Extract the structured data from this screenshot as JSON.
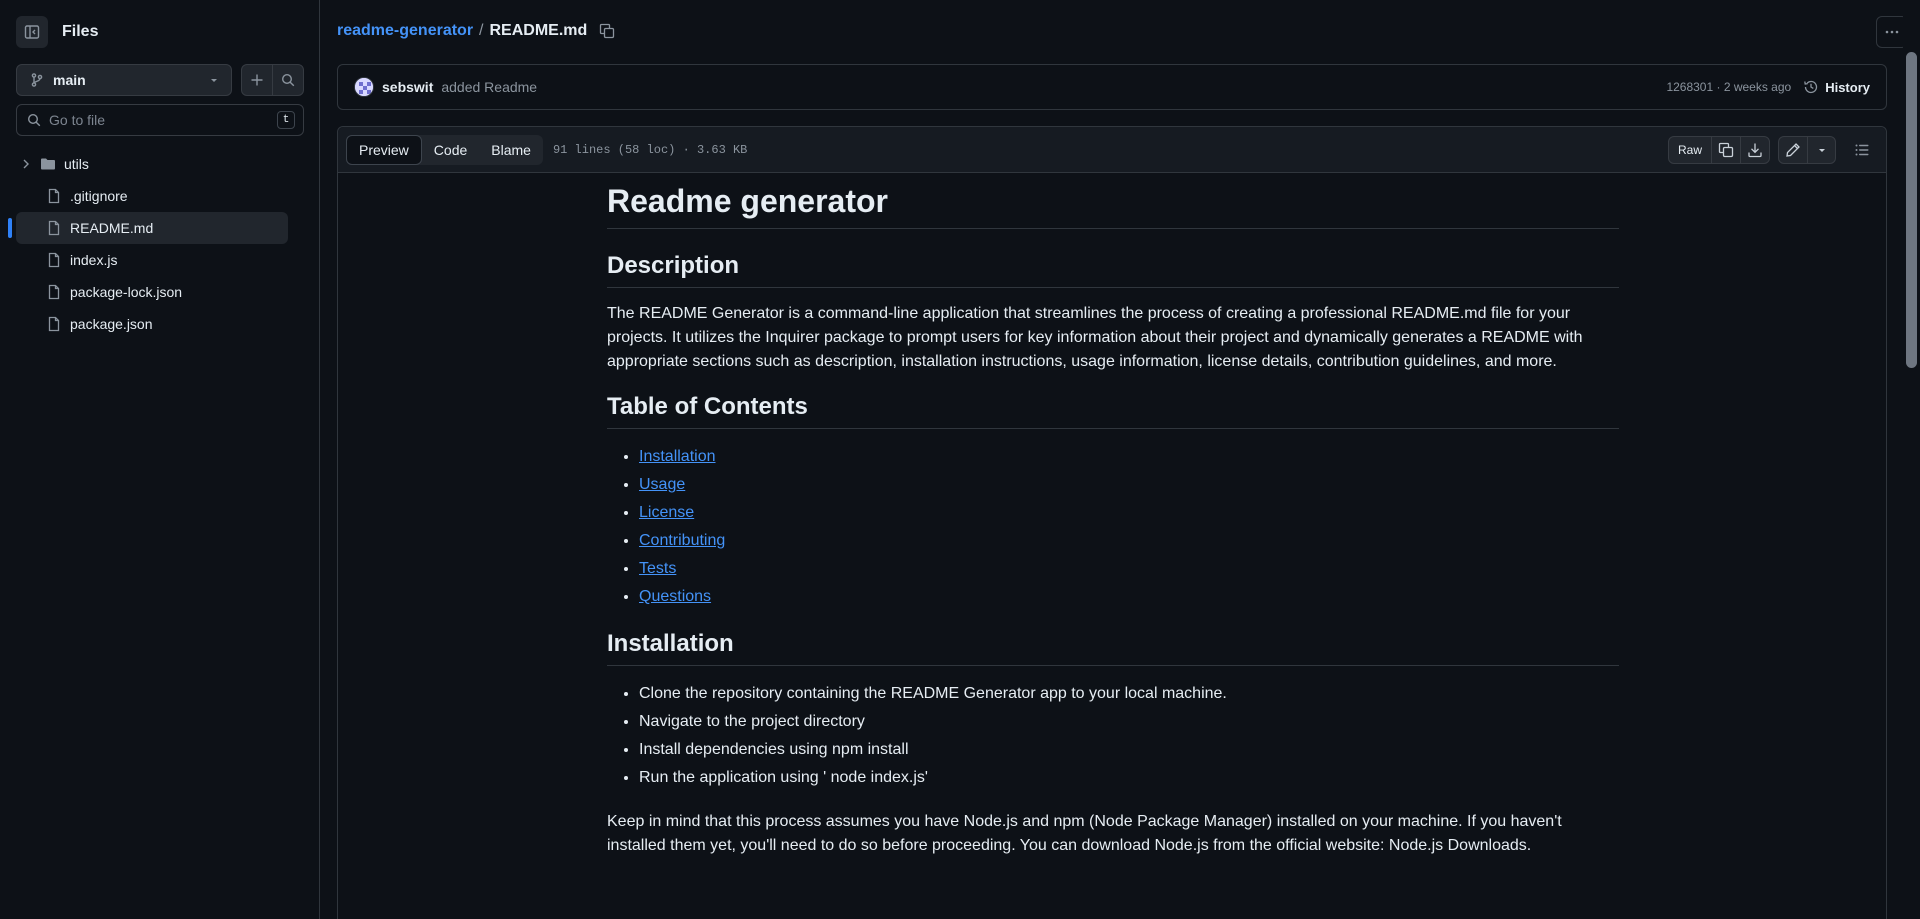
{
  "sidebar": {
    "title": "Files",
    "branch": "main",
    "goto_placeholder": "Go to file",
    "goto_shortcut": "t",
    "tree": [
      {
        "name": "utils",
        "type": "folder"
      },
      {
        "name": ".gitignore",
        "type": "file"
      },
      {
        "name": "README.md",
        "type": "file",
        "selected": true
      },
      {
        "name": "index.js",
        "type": "file"
      },
      {
        "name": "package-lock.json",
        "type": "file"
      },
      {
        "name": "package.json",
        "type": "file"
      }
    ]
  },
  "breadcrumb": {
    "repo": "readme-generator",
    "separator": "/",
    "file": "README.md"
  },
  "commit": {
    "author": "sebswit",
    "message": "added Readme",
    "meta": "1268301 · 2 weeks ago",
    "history_label": "History"
  },
  "file_header": {
    "tabs": [
      "Preview",
      "Code",
      "Blame"
    ],
    "active_tab": "Preview",
    "info": "91 lines (58 loc) · 3.63 KB",
    "raw_label": "Raw"
  },
  "readme": {
    "title": "Readme generator",
    "description_heading": "Description",
    "description": "The README Generator is a command-line application that streamlines the process of creating a professional README.md file for your projects. It utilizes the Inquirer package to prompt users for key information about their project and dynamically generates a README with appropriate sections such as description, installation instructions, usage information, license details, contribution guidelines, and more.",
    "toc_heading": "Table of Contents",
    "toc": [
      "Installation",
      "Usage",
      "License",
      "Contributing",
      "Tests",
      "Questions"
    ],
    "installation_heading": "Installation",
    "installation_steps": [
      "Clone the repository containing the README Generator app to your local machine.",
      "Navigate to the project directory",
      "Install dependencies using npm install",
      "Run the application using ' node index.js'"
    ],
    "installation_note": "Keep in mind that this process assumes you have Node.js and npm (Node Package Manager) installed on your machine. If you haven't installed them yet, you'll need to do so before proceeding. You can download Node.js from the official website: Node.js Downloads."
  },
  "colors": {
    "background": "#0d1117",
    "border": "#30363d",
    "link": "#4493f8",
    "text": "#e6edf3",
    "muted": "#8b949e"
  }
}
